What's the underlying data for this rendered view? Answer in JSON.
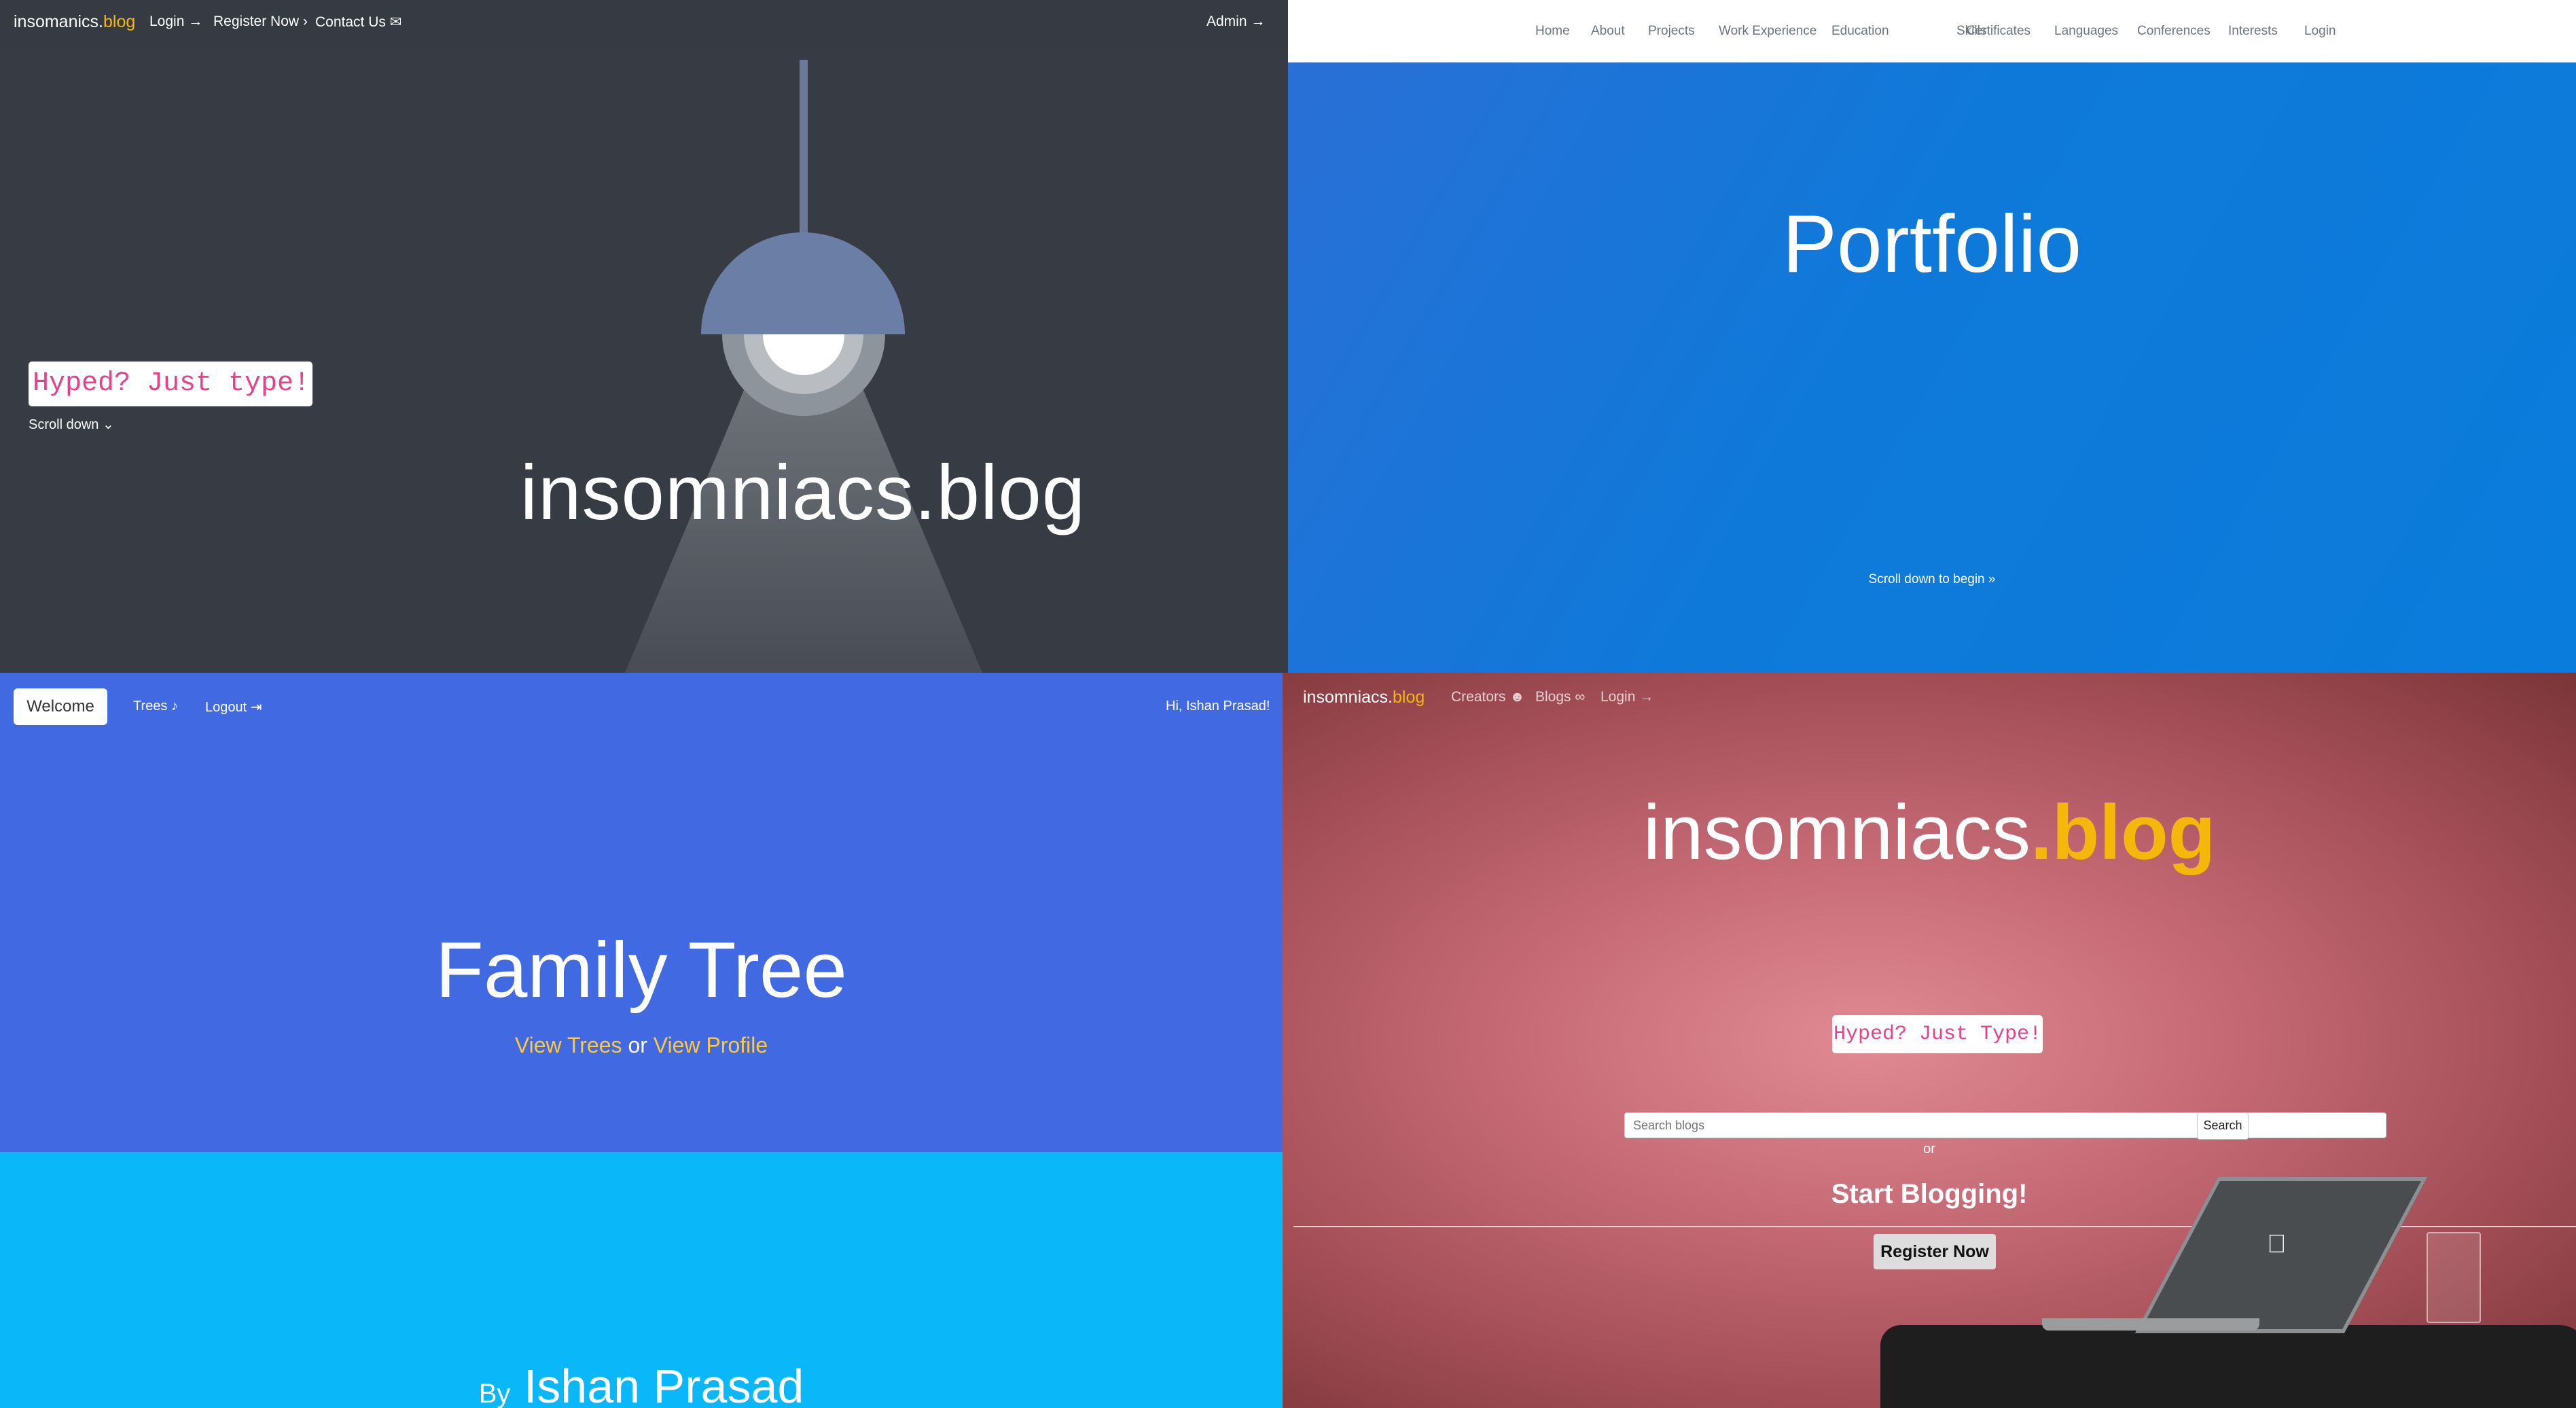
{
  "q1": {
    "brand": "insomanics.",
    "brand_tld": "blog",
    "nav": [
      {
        "label": "Login",
        "icon": "sign-in-icon",
        "glyph": "→"
      },
      {
        "label": "Register Now",
        "icon": "chevron-right-icon",
        "glyph": "›"
      },
      {
        "label": "Contact Us",
        "icon": "inbox-icon",
        "glyph": "✉"
      }
    ],
    "admin": "Admin",
    "admin_icon": "→",
    "title": "insomniacs.blog",
    "typebox": "Hyped? Just type!",
    "scroll": "Scroll down",
    "scroll_icon": "⌄"
  },
  "q2": {
    "nav": [
      "Home",
      "About",
      "Projects",
      "Work Experience",
      "Education",
      "Skills",
      "Certificates",
      "Languages",
      "Conferences",
      "Interests",
      "Login"
    ],
    "title": "Portfolio",
    "scroll": "Scroll down to begin",
    "scroll_icon": "»"
  },
  "q3": {
    "welcome": "Welcome",
    "trees": "Trees",
    "trees_icon": "♪",
    "logout": "Logout",
    "logout_icon": "⇥",
    "greeting": "Hi, Ishan Prasad!",
    "title": "Family Tree",
    "view_trees": "View Trees",
    "or": " or ",
    "view_profile": "View Profile",
    "by": "By",
    "author": "Ishan Prasad"
  },
  "q4": {
    "brand": "insomniacs.",
    "brand_tld": "blog",
    "nav": [
      {
        "label": "Creators",
        "icon": "users-icon",
        "glyph": "☻"
      },
      {
        "label": "Blogs",
        "icon": "link-icon",
        "glyph": "∞"
      },
      {
        "label": "Login",
        "icon": "sign-in-icon",
        "glyph": "→"
      }
    ],
    "title": "insomniacs",
    "title_tld": ".blog",
    "typebox": "Hyped? Just Type!",
    "search_placeholder": "Search blogs",
    "search_button": "Search",
    "or": "or",
    "start": "Start Blogging!",
    "register": "Register Now",
    "apple_logo": ""
  }
}
